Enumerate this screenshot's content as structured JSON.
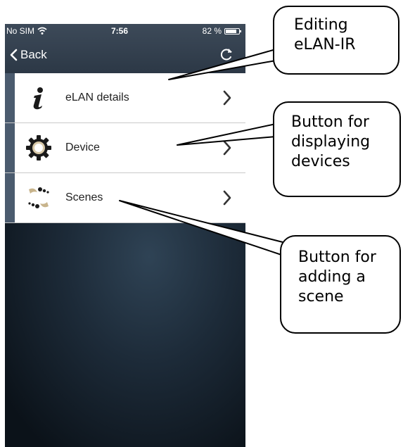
{
  "status_bar": {
    "carrier": "No SIM",
    "time": "7:56",
    "battery": "82 %"
  },
  "nav": {
    "back_label": "Back"
  },
  "menu": {
    "items": [
      {
        "label": "eLAN details"
      },
      {
        "label": "Device"
      },
      {
        "label": "Scenes"
      }
    ]
  },
  "callouts": [
    {
      "lines": [
        "Editing",
        "eLAN-IR"
      ]
    },
    {
      "lines": [
        "Button for",
        "displaying",
        "devices"
      ]
    },
    {
      "lines": [
        "Button for",
        "adding a",
        "scene"
      ]
    }
  ],
  "colors": {
    "navbar": "#2c3846",
    "accent_bar": "#4b5b6e",
    "background_dark": "#0b1219"
  },
  "icons": {
    "menu": [
      "info-icon",
      "gear-icon",
      "scenes-icon"
    ]
  }
}
